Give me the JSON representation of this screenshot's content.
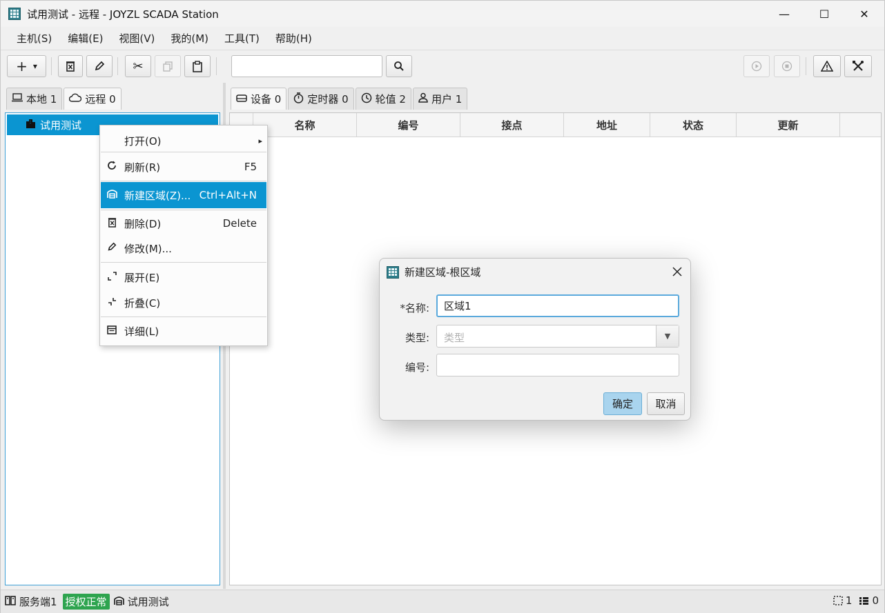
{
  "window": {
    "title": "试用测试 - 远程 - JOYZL SCADA Station",
    "minimize_glyph": "—",
    "maximize_glyph": "☐",
    "close_glyph": "✕"
  },
  "menubar": [
    "主机(S)",
    "编辑(E)",
    "视图(V)",
    "我的(M)",
    "工具(T)",
    "帮助(H)"
  ],
  "toolbar": {
    "add_glyph": "+",
    "add_dropdown_glyph": "▾",
    "delete_icon": "delete-icon",
    "edit_icon": "pencil-icon",
    "cut_icon": "scissors-icon",
    "copy_icon": "copy-icon",
    "paste_icon": "clipboard-icon",
    "search_value": "",
    "search_icon": "search-icon",
    "play_icon": "play-icon",
    "stop_icon": "stop-icon",
    "alarm_icon": "warning-icon",
    "tools_icon": "tools-icon"
  },
  "left_tabs": [
    {
      "icon": "laptop-icon",
      "label": "本地 1"
    },
    {
      "icon": "cloud-icon",
      "label": "远程 0"
    }
  ],
  "tree": {
    "selected_label": "试用测试",
    "icon": "building-icon"
  },
  "right_tabs": [
    {
      "icon": "device-icon",
      "label": "设备 0"
    },
    {
      "icon": "timer-icon",
      "label": "定时器 0"
    },
    {
      "icon": "clock-icon",
      "label": "轮值 2"
    },
    {
      "icon": "user-icon",
      "label": "用户 1"
    }
  ],
  "table": {
    "columns": [
      "",
      "名称",
      "编号",
      "接点",
      "地址",
      "状态",
      "更新",
      ""
    ]
  },
  "context_menu": {
    "items": [
      {
        "label": "打开(O)",
        "shortcut": "",
        "icon": "",
        "submenu": "▸"
      },
      {
        "label": "刷新(R)",
        "shortcut": "F5",
        "icon": "refresh-icon"
      },
      {
        "label": "新建区域(Z)...",
        "shortcut": "Ctrl+Alt+N",
        "icon": "area-icon",
        "highlighted": true
      },
      {
        "label": "删除(D)",
        "shortcut": "Delete",
        "icon": "delete-icon"
      },
      {
        "label": "修改(M)...",
        "shortcut": "",
        "icon": "pencil-icon"
      },
      {
        "label": "展开(E)",
        "shortcut": "",
        "icon": "expand-icon"
      },
      {
        "label": "折叠(C)",
        "shortcut": "",
        "icon": "collapse-icon"
      },
      {
        "label": "详细(L)",
        "shortcut": "",
        "icon": "details-icon"
      }
    ]
  },
  "dialog": {
    "title": "新建区域-根区域",
    "name_label": "*名称:",
    "name_value": "区域1",
    "type_label": "类型:",
    "type_placeholder": "类型",
    "number_label": "编号:",
    "number_value": "",
    "ok_label": "确定",
    "cancel_label": "取消"
  },
  "statusbar": {
    "server_label": "服务端1",
    "license_label": "授权正常",
    "current_label": "试用测试",
    "selection_count": "1",
    "list_count": "0",
    "license_color": "#2ea44f"
  },
  "colors": {
    "accent": "#0b95d1",
    "focus": "#5aa9dc"
  }
}
